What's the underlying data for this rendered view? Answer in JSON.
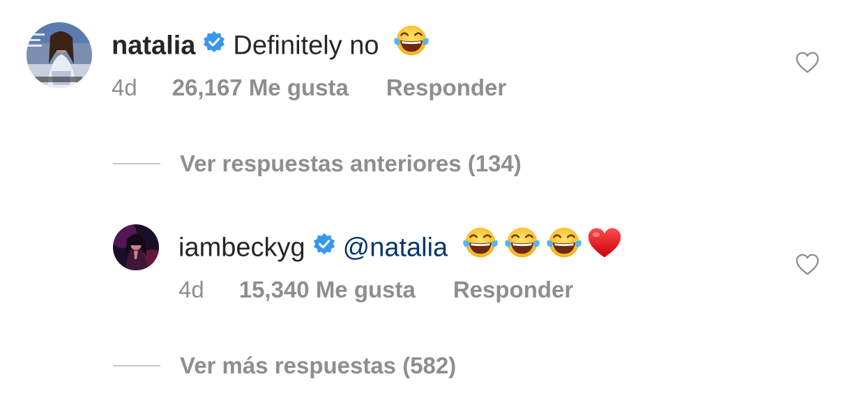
{
  "comments": [
    {
      "username": "natalia",
      "text": "Definitely no",
      "emojis": [
        "face-with-tears-of-joy"
      ],
      "time": "4d",
      "likes": "26,167 Me gusta",
      "reply_label": "Responder"
    },
    {
      "username": "iambeckyg",
      "mention": "@natalia",
      "emojis": [
        "face-with-tears-of-joy",
        "face-with-tears-of-joy",
        "face-with-tears-of-joy",
        "red-heart"
      ],
      "time": "4d",
      "likes": "15,340 Me gusta",
      "reply_label": "Responder"
    }
  ],
  "replies_toggle": {
    "previous_label": "Ver respuestas anteriores (134)",
    "more_label": "Ver más respuestas (582)"
  },
  "colors": {
    "verified": "#3897f0",
    "mention": "#00376b",
    "meta": "#8e8e8e",
    "text": "#262626"
  }
}
